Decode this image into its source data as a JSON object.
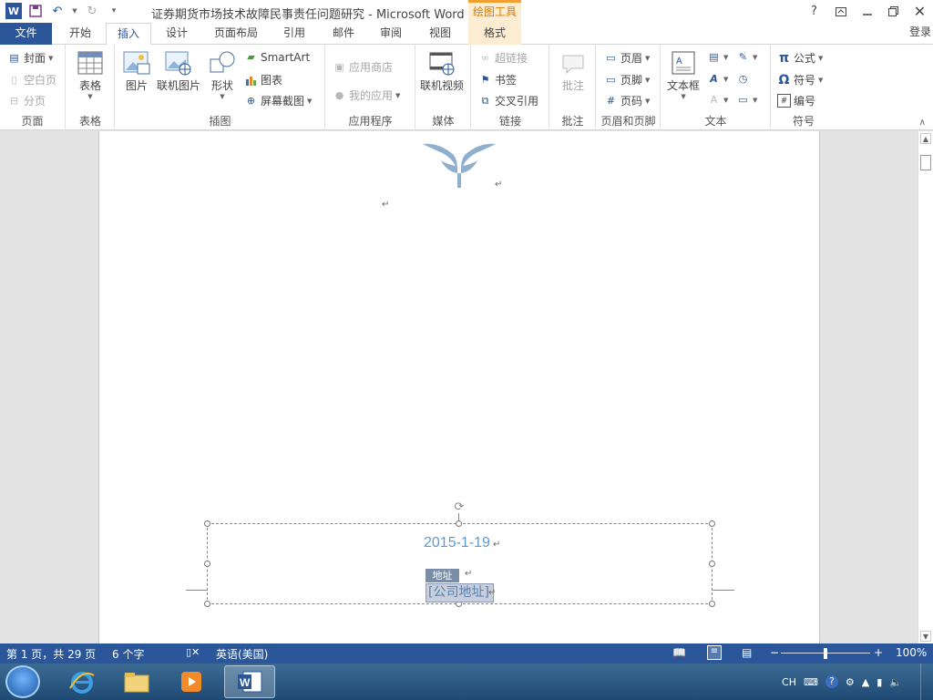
{
  "window": {
    "title": "证券期货市场技术故障民事责任问题研究 - Microsoft Word",
    "context_tab_title": "绘图工具",
    "help": "?",
    "login": "登录"
  },
  "tabs": [
    {
      "label": "文件"
    },
    {
      "label": "开始"
    },
    {
      "label": "插入"
    },
    {
      "label": "设计"
    },
    {
      "label": "页面布局"
    },
    {
      "label": "引用"
    },
    {
      "label": "邮件"
    },
    {
      "label": "审阅"
    },
    {
      "label": "视图"
    },
    {
      "label": "格式"
    }
  ],
  "ribbon": {
    "pages": {
      "label": "页面",
      "cover": "封面",
      "blank": "空白页",
      "break": "分页"
    },
    "tables": {
      "label": "表格",
      "table": "表格"
    },
    "illustrations": {
      "label": "插图",
      "picture": "图片",
      "online_picture": "联机图片",
      "shapes": "形状",
      "smartart": "SmartArt",
      "chart": "图表",
      "screenshot": "屏幕截图"
    },
    "apps": {
      "label": "应用程序",
      "store": "应用商店",
      "my_apps": "我的应用"
    },
    "media": {
      "label": "媒体",
      "online_video": "联机视频"
    },
    "links": {
      "label": "链接",
      "hyperlink": "超链接",
      "bookmark": "书签",
      "cross_ref": "交叉引用"
    },
    "comments": {
      "label": "批注",
      "comment": "批注"
    },
    "header_footer": {
      "label": "页眉和页脚",
      "header": "页眉",
      "footer": "页脚",
      "page_number": "页码"
    },
    "text": {
      "label": "文本",
      "textbox": "文本框"
    },
    "symbols": {
      "label": "符号",
      "equation": "公式",
      "symbol": "符号",
      "number": "编号"
    }
  },
  "document": {
    "date": "2015-1-19",
    "address_tag": "地址",
    "address_placeholder": "[公司地址]"
  },
  "status": {
    "page": "第 1 页，共 29 页",
    "words": "6 个字",
    "language": "英语(美国)",
    "zoom": "100%"
  },
  "taskbar": {
    "ime": "CH"
  },
  "colors": {
    "word_blue": "#2b579a",
    "context_orange": "#d87a00",
    "date_blue": "#5b9bd5"
  }
}
